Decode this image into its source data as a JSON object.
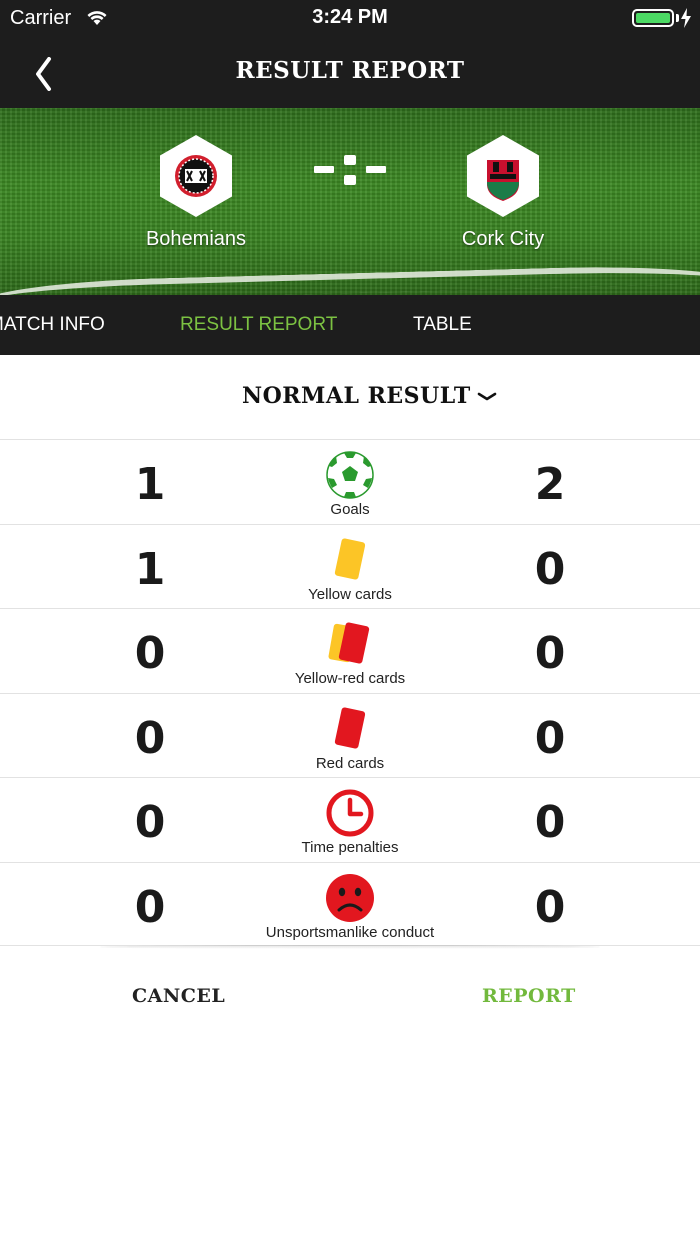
{
  "status_bar": {
    "carrier": "Carrier",
    "time": "3:24 PM"
  },
  "nav": {
    "title": "RESULT REPORT"
  },
  "match": {
    "home_team": "Bohemians",
    "away_team": "Cork City",
    "score_separator": "- : -"
  },
  "tabs": [
    {
      "label": "MATCH INFO",
      "active": false
    },
    {
      "label": "RESULT REPORT",
      "active": true
    },
    {
      "label": "TABLE",
      "active": false
    }
  ],
  "result_type": {
    "label": "NORMAL RESULT"
  },
  "stats": [
    {
      "label": "Goals",
      "icon": "soccer-ball-icon",
      "home": "1",
      "away": "2"
    },
    {
      "label": "Yellow cards",
      "icon": "yellow-card-icon",
      "home": "1",
      "away": "0"
    },
    {
      "label": "Yellow-red cards",
      "icon": "yellow-red-card-icon",
      "home": "0",
      "away": "0"
    },
    {
      "label": "Red cards",
      "icon": "red-card-icon",
      "home": "0",
      "away": "0"
    },
    {
      "label": "Time penalties",
      "icon": "clock-icon",
      "home": "0",
      "away": "0"
    },
    {
      "label": "Unsportsmanlike conduct",
      "icon": "sad-face-icon",
      "home": "0",
      "away": "0"
    }
  ],
  "actions": {
    "cancel": "CANCEL",
    "report": "REPORT"
  },
  "colors": {
    "accent": "#7cc242",
    "bar": "#1d1d1d",
    "red": "#e2171f",
    "yellow": "#fcc526",
    "green": "#2a9a2e"
  }
}
